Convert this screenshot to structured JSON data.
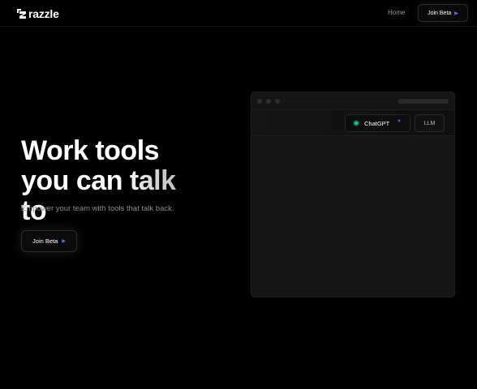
{
  "brand": {
    "name": "razzle",
    "logo_icon": "razzle-logo-icon"
  },
  "nav": {
    "home_label": "Home",
    "cta_label": "Join Beta",
    "cta_icon": "play-arrow-icon",
    "accent_color": "#6b6bff"
  },
  "hero": {
    "title_line1": "Work tools",
    "title_line2": "you can talk to",
    "subtitle": "Empower your team with tools that talk back.",
    "cta_label": "Join Beta"
  },
  "app_preview": {
    "model_selected": "ChatGPT",
    "model_icon_color": "#19c37d",
    "alt_option": "LLM"
  }
}
